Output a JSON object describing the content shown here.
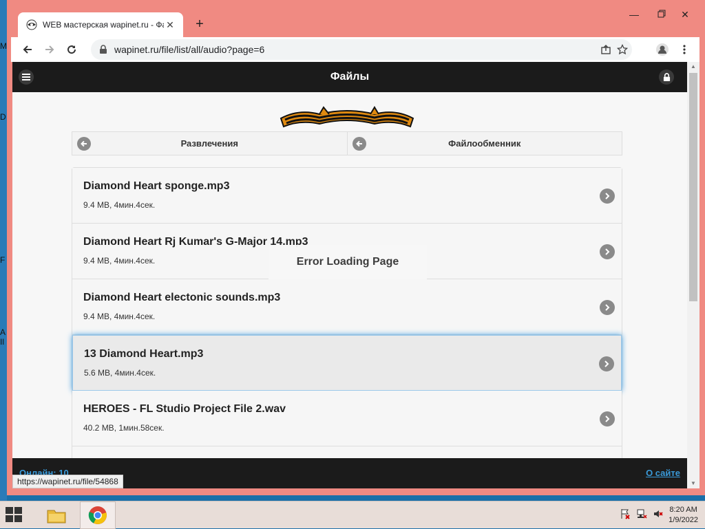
{
  "desktop_glyphs": [
    "M",
    "D",
    "F",
    "A",
    "Il"
  ],
  "browser": {
    "tab_title": "WEB мастерская wapinet.ru - Фа",
    "url": "wapinet.ru/file/list/all/audio?page=6",
    "status_url": "https://wapinet.ru/file/54868"
  },
  "app": {
    "title": "Файлы",
    "nav": [
      {
        "label": "Развлечения"
      },
      {
        "label": "Файлообменник"
      }
    ],
    "files": [
      {
        "name": "Diamond Heart sponge.mp3",
        "meta": "9.4 MB, 4мин.4сек."
      },
      {
        "name": "Diamond Heart Rj Kumar's G-Major 14.mp3",
        "meta": "9.4 MB, 4мин.4сек."
      },
      {
        "name": "Diamond Heart electonic sounds.mp3",
        "meta": "9.4 MB, 4мин.4сек."
      },
      {
        "name": "13 Diamond Heart.mp3",
        "meta": "5.6 MB, 4мин.4сек."
      },
      {
        "name": "HEROES - FL Studio Project File 2.wav",
        "meta": "40.2 MB, 1мин.58сек."
      }
    ],
    "error_message": "Error Loading Page",
    "footer": {
      "online": "Онлайн: 10",
      "about": "О сайте"
    }
  },
  "taskbar": {
    "time": "8:20 AM",
    "date": "1/9/2022"
  },
  "colors": {
    "window_frame": "#f08a82",
    "header_bg": "#1b1b1b",
    "link": "#3a9ad9"
  }
}
